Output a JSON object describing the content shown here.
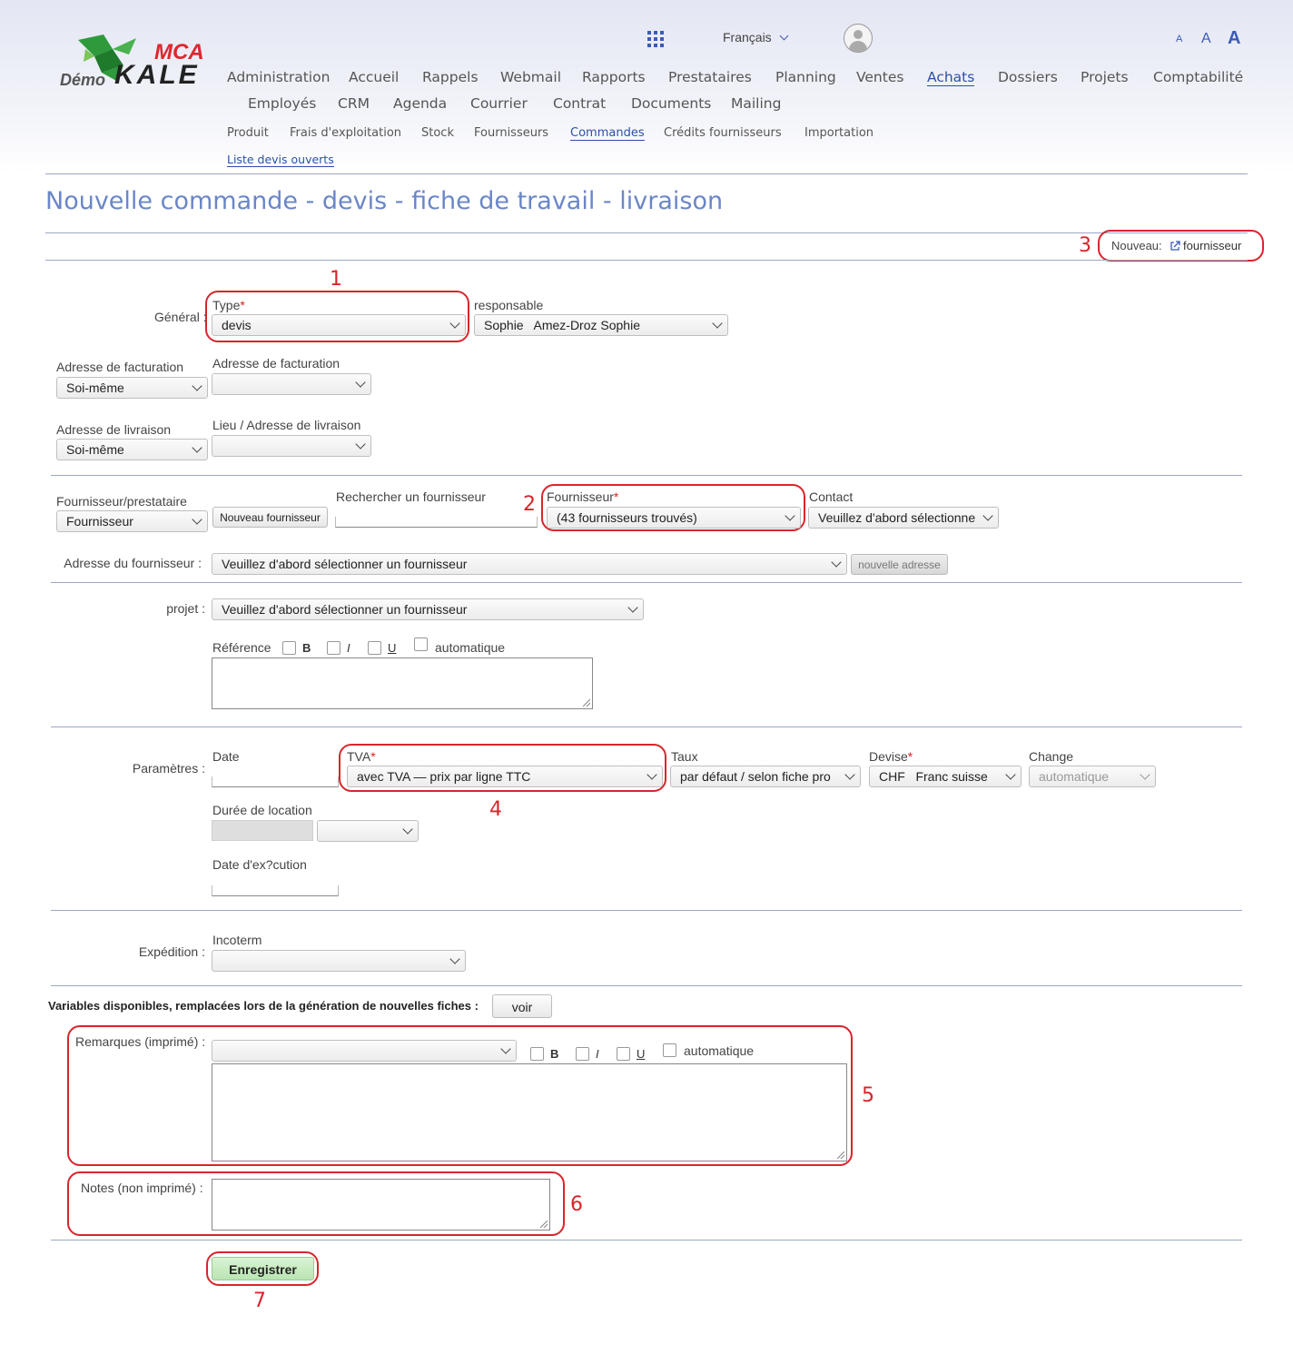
{
  "header": {
    "logo_demo": "Démo",
    "logo_mca": "MCA",
    "logo_kale": "KALE",
    "language": "Français",
    "font_sizes": [
      "A",
      "A",
      "A"
    ]
  },
  "nav": {
    "main": [
      "Administration",
      "Accueil",
      "Rappels",
      "Webmail",
      "Rapports",
      "Prestataires",
      "Planning",
      "Ventes",
      "Achats",
      "Dossiers",
      "Projets",
      "Comptabilité",
      "Employés",
      "CRM",
      "Agenda",
      "Courrier",
      "Contrat",
      "Documents",
      "Mailing"
    ],
    "sub": [
      "Produit",
      "Frais d'exploitation",
      "Stock",
      "Fournisseurs",
      "Commandes",
      "Crédits fournisseurs",
      "Importation"
    ],
    "sub2": "Liste devis ouverts"
  },
  "page_title": "Nouvelle commande - devis - fiche de travail - livraison",
  "nouveau": {
    "label": "Nouveau:",
    "link": "fournisseur"
  },
  "general": {
    "label": "Général :",
    "type_label": "Type",
    "type_value": "devis",
    "responsable_label": "responsable",
    "responsable_value": "Sophie   Amez-Droz Sophie"
  },
  "billing": {
    "left_label": "Adresse de facturation",
    "left_value": "Soi-même",
    "right_label": "Adresse de facturation",
    "right_value": ""
  },
  "delivery": {
    "left_label": "Adresse de livraison",
    "left_value": "Soi-même",
    "right_label": "Lieu / Adresse de livraison",
    "right_value": ""
  },
  "supplier": {
    "kind_label": "Fournisseur/prestataire",
    "kind_value": "Fournisseur",
    "new_button": "Nouveau fournisseur",
    "search_label": "Rechercher un fournisseur",
    "supplier_label": "Fournisseur",
    "supplier_value": "(43 fournisseurs trouvés)",
    "contact_label": "Contact",
    "contact_value": "Veuillez d'abord sélectionne",
    "address_label": "Adresse du fournisseur :",
    "address_value": "Veuillez d'abord sélectionner un fournisseur",
    "new_address_button": "nouvelle adresse"
  },
  "project": {
    "label": "projet :",
    "value": "Veuillez d'abord sélectionner un fournisseur",
    "reference_label": "Référence",
    "bold": "B",
    "italic": "I",
    "underline": "U",
    "auto": "automatique"
  },
  "params": {
    "label": "Paramètres :",
    "date_label": "Date",
    "tva_label": "TVA",
    "tva_value": "avec TVA — prix par ligne TTC",
    "taux_label": "Taux",
    "taux_value": "par défaut / selon fiche pro",
    "devise_label": "Devise",
    "devise_value": "CHF   Franc suisse",
    "change_label": "Change",
    "change_value": "automatique",
    "duree_label": "Durée de location",
    "exec_label": "Date d'ex?cution"
  },
  "shipping": {
    "label": "Expédition :",
    "incoterm_label": "Incoterm",
    "incoterm_value": ""
  },
  "variables": {
    "label": "Variables disponibles, remplacées lors de la génération de nouvelles fiches :",
    "button": "voir"
  },
  "remarks": {
    "label": "Remarques (imprimé) :",
    "bold": "B",
    "italic": "I",
    "underline": "U",
    "auto": "automatique"
  },
  "notes": {
    "label": "Notes (non imprimé) :"
  },
  "save_button": "Enregistrer",
  "annotations": [
    "1",
    "2",
    "3",
    "4",
    "5",
    "6",
    "7"
  ],
  "colors": {
    "accent": "#2d4fa8",
    "title": "#6b86c8",
    "annotation": "#d8252b",
    "save": "#c9ecc4"
  }
}
